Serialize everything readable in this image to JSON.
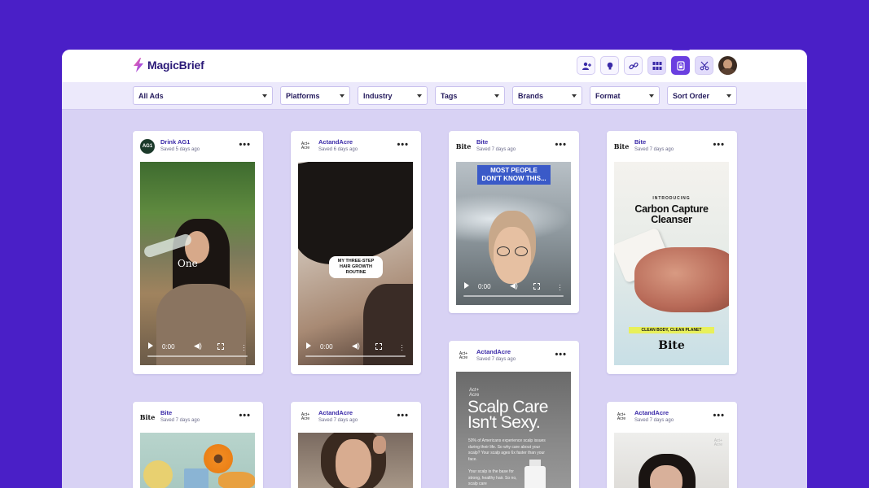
{
  "app": {
    "name": "MagicBrief"
  },
  "header_actions": [
    "add-user-icon",
    "lightbulb-icon",
    "link-icon",
    "grid-icon",
    "lock-icon",
    "scissors-icon"
  ],
  "filters": [
    {
      "label": "All Ads"
    },
    {
      "label": "Platforms"
    },
    {
      "label": "Industry"
    },
    {
      "label": "Tags"
    },
    {
      "label": "Brands"
    },
    {
      "label": "Format"
    },
    {
      "label": "Sort Order"
    }
  ],
  "cards": [
    {
      "brand": "Drink AG1",
      "saved": "Saved 5 days ago",
      "logo": "AG1",
      "overlay": "One",
      "time": "0:00"
    },
    {
      "brand": "ActandAcre",
      "saved": "Saved 6 days ago",
      "logo": "Act+\nAcre",
      "overlay": "MY THREE-STEP HAIR GROWTH ROUTINE",
      "time": "0:00"
    },
    {
      "brand": "Bite",
      "saved": "Saved 7 days ago",
      "logo": "Bite",
      "overlay": "MOST PEOPLE DON'T KNOW THIS...",
      "time": "0:00"
    },
    {
      "brand": "Bite",
      "saved": "Saved 7 days ago",
      "logo": "Bite",
      "intro": "INTRODUCING",
      "title": "Carbon Capture Cleanser",
      "tagline": "CLEAN BODY, CLEAN PLANET",
      "wordmark": "Bite"
    },
    {
      "brand": "ActandAcre",
      "saved": "Saved 7 days ago",
      "logo": "Act+\nAcre",
      "mark": "Act+\nAcre",
      "title": "Scalp Care Isn't Sexy.",
      "body": "50% of Americans experience scalp issues during their life. So why care about your scalp? Your scalp ages 6x faster than your face.",
      "body2": "Your scalp is the base for strong, healthy hair. So no, scalp care"
    },
    {
      "brand": "Bite",
      "saved": "Saved 7 days ago",
      "logo": "Bite"
    },
    {
      "brand": "ActandAcre",
      "saved": "Saved 7 days ago",
      "logo": "Act+\nAcre"
    },
    {
      "brand": "ActandAcre",
      "saved": "Saved 7 days ago",
      "logo": "Act+\nAcre",
      "mark": "Act+\nAcre"
    }
  ]
}
